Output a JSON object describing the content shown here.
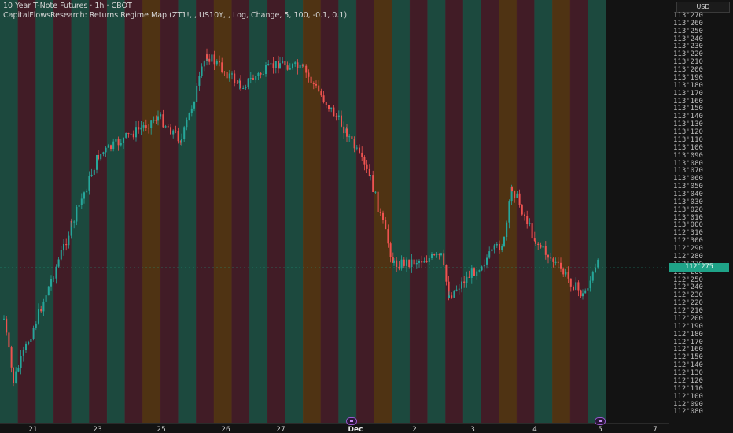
{
  "header": {
    "title": "10 Year T-Note Futures · 1h · CBOT",
    "indicator": "CapitalFlowsResearch: Returns Regime Map (ZT1!, , US10Y, , Log, Change, 5, 100, -0.1, 0.1)"
  },
  "price_axis": {
    "currency": "USD",
    "current_price": "112'275",
    "ticks": [
      "113'270",
      "113'260",
      "113'250",
      "113'240",
      "113'230",
      "113'220",
      "113'210",
      "113'200",
      "113'190",
      "113'180",
      "113'170",
      "113'160",
      "113'150",
      "113'140",
      "113'130",
      "113'120",
      "113'110",
      "113'100",
      "113'090",
      "113'080",
      "113'070",
      "113'060",
      "113'050",
      "113'040",
      "113'030",
      "113'020",
      "113'010",
      "113'000",
      "112'310",
      "112'300",
      "112'290",
      "112'280",
      "112'270",
      "112'260",
      "112'250",
      "112'240",
      "112'230",
      "112'220",
      "112'210",
      "112'200",
      "112'190",
      "112'180",
      "112'170",
      "112'160",
      "112'150",
      "112'140",
      "112'130",
      "112'120",
      "112'110",
      "112'100",
      "112'090",
      "112'080"
    ]
  },
  "time_axis": {
    "ticks": [
      {
        "label": "21",
        "bold": false
      },
      {
        "label": "23",
        "bold": false
      },
      {
        "label": "25",
        "bold": false
      },
      {
        "label": "26",
        "bold": false
      },
      {
        "label": "27",
        "bold": false
      },
      {
        "label": "Dec",
        "bold": true
      },
      {
        "label": "2",
        "bold": false
      },
      {
        "label": "3",
        "bold": false
      },
      {
        "label": "4",
        "bold": false
      },
      {
        "label": "5",
        "bold": false
      },
      {
        "label": "7",
        "bold": false
      }
    ]
  },
  "colors": {
    "background": "#131313",
    "up_candle": "#26a69a",
    "down_candle": "#ef5350",
    "regime_green": "#1e5446",
    "regime_red": "#4a1f2a",
    "regime_orange": "#5a3a14",
    "price_badge": "#1fa388"
  },
  "chart_data": {
    "type": "candlestick",
    "title": "10 Year T-Note Futures · 1h · CBOT",
    "y_unit": "32nds (112'xxx)",
    "ylim_label": [
      "112'080",
      "113'270"
    ],
    "regime_bands": [
      "green",
      "red",
      "green",
      "red",
      "green",
      "red",
      "green",
      "red",
      "orange",
      "red",
      "green",
      "red",
      "orange",
      "red",
      "green",
      "red",
      "green",
      "orange",
      "red",
      "green",
      "red",
      "orange",
      "green",
      "red",
      "green",
      "red",
      "green",
      "red",
      "orange",
      "red",
      "green",
      "orange",
      "red",
      "green"
    ],
    "close_path_keypoints": [
      [
        "21",
        "112'200"
      ],
      [
        "21",
        "112'120"
      ],
      [
        "22",
        "113'000"
      ],
      [
        "23",
        "113'090"
      ],
      [
        "25",
        "113'140"
      ],
      [
        "25",
        "113'110"
      ],
      [
        "26",
        "113'220"
      ],
      [
        "26",
        "113'180"
      ],
      [
        "27",
        "113'210"
      ],
      [
        "27",
        "113'200"
      ],
      [
        "Dec",
        "113'120"
      ],
      [
        "Dec",
        "113'060"
      ],
      [
        "2",
        "112'270"
      ],
      [
        "2",
        "112'280"
      ],
      [
        "3",
        "112'230"
      ],
      [
        "3",
        "112'300"
      ],
      [
        "4",
        "113'050"
      ],
      [
        "4",
        "112'300"
      ],
      [
        "5",
        "112'230"
      ],
      [
        "5",
        "112'275"
      ]
    ]
  }
}
